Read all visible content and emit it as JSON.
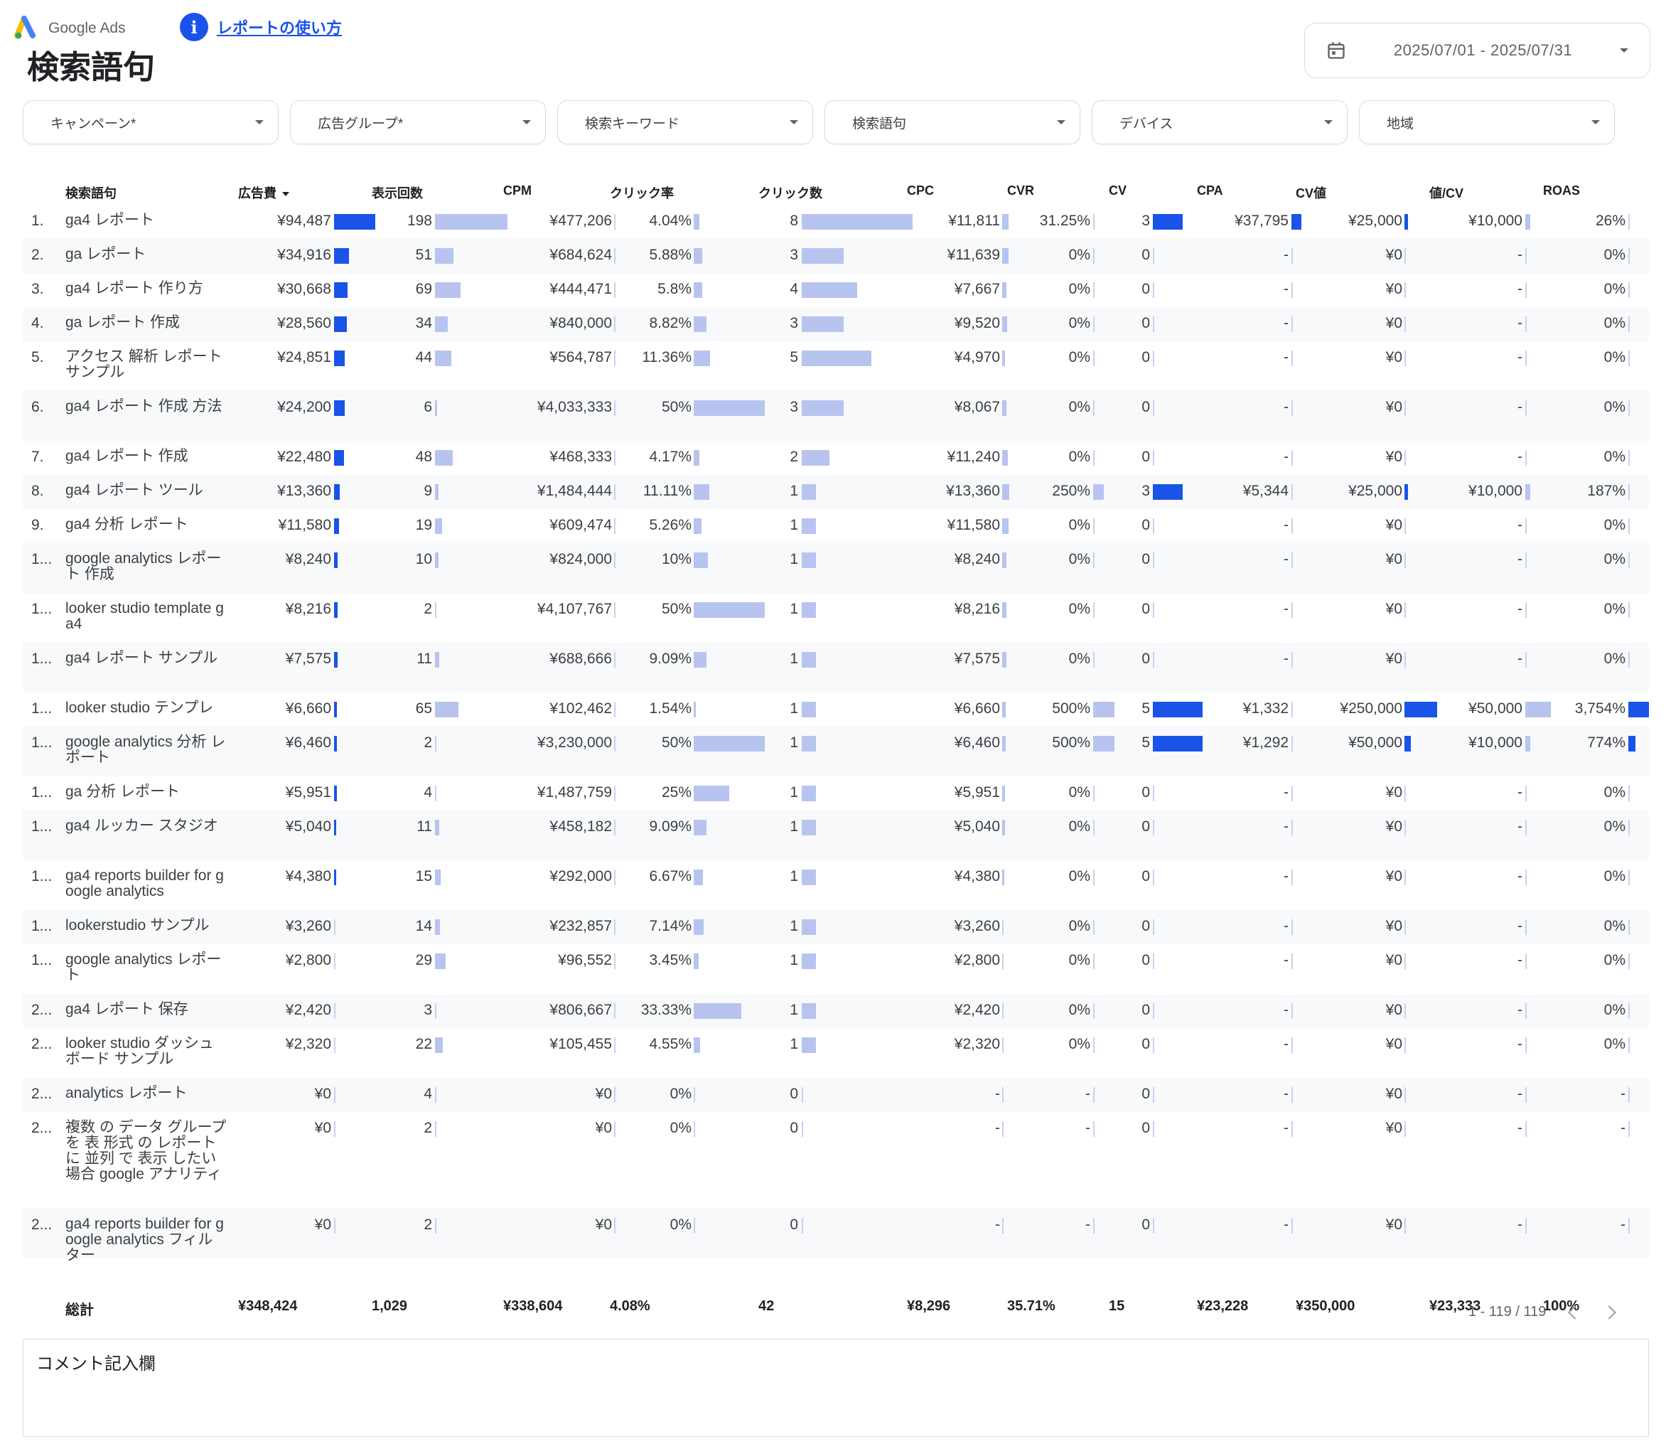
{
  "header": {
    "logo_text": "Google Ads",
    "help_label": "レポートの使い方",
    "title": "検索語句",
    "date_range": "2025/07/01 - 2025/07/31"
  },
  "filters": [
    "キャンペーン*",
    "広告グループ*",
    "検索キーワード",
    "検索語句",
    "デバイス",
    "地域"
  ],
  "columns": [
    "検索語句",
    "広告費",
    "表示回数",
    "CPM",
    "クリック率",
    "クリック数",
    "CPC",
    "CVR",
    "CV",
    "CPA",
    "CV値",
    "値/CV",
    "ROAS"
  ],
  "rows": [
    {
      "idx": "1.",
      "term": "ga4 レポート",
      "cost": "¥94,487",
      "imp": "198",
      "cpm": "¥477,206",
      "ctr": "4.04%",
      "clicks": "8",
      "cpc": "¥11,811",
      "cvr": "31.25%",
      "cv": "3",
      "cpa": "¥37,795",
      "cvv": "¥25,000",
      "vcv": "¥10,000",
      "roas": "26%"
    },
    {
      "idx": "2.",
      "term": "ga レポート",
      "cost": "¥34,916",
      "imp": "51",
      "cpm": "¥684,624",
      "ctr": "5.88%",
      "clicks": "3",
      "cpc": "¥11,639",
      "cvr": "0%",
      "cv": "0",
      "cpa": "-",
      "cvv": "¥0",
      "vcv": "-",
      "roas": "0%"
    },
    {
      "idx": "3.",
      "term": "ga4 レポート 作り方",
      "cost": "¥30,668",
      "imp": "69",
      "cpm": "¥444,471",
      "ctr": "5.8%",
      "clicks": "4",
      "cpc": "¥7,667",
      "cvr": "0%",
      "cv": "0",
      "cpa": "-",
      "cvv": "¥0",
      "vcv": "-",
      "roas": "0%"
    },
    {
      "idx": "4.",
      "term": "ga レポート 作成",
      "cost": "¥28,560",
      "imp": "34",
      "cpm": "¥840,000",
      "ctr": "8.82%",
      "clicks": "3",
      "cpc": "¥9,520",
      "cvr": "0%",
      "cv": "0",
      "cpa": "-",
      "cvv": "¥0",
      "vcv": "-",
      "roas": "0%"
    },
    {
      "idx": "5.",
      "term": "アクセス 解析 レポート サンプル",
      "cost": "¥24,851",
      "imp": "44",
      "cpm": "¥564,787",
      "ctr": "11.36%",
      "clicks": "5",
      "cpc": "¥4,970",
      "cvr": "0%",
      "cv": "0",
      "cpa": "-",
      "cvv": "¥0",
      "vcv": "-",
      "roas": "0%"
    },
    {
      "idx": "6.",
      "term": "ga4 レポート 作成 方法",
      "cost": "¥24,200",
      "imp": "6",
      "cpm": "¥4,033,333",
      "ctr": "50%",
      "clicks": "3",
      "cpc": "¥8,067",
      "cvr": "0%",
      "cv": "0",
      "cpa": "-",
      "cvv": "¥0",
      "vcv": "-",
      "roas": "0%"
    },
    {
      "idx": "7.",
      "term": "ga4 レポート 作成",
      "cost": "¥22,480",
      "imp": "48",
      "cpm": "¥468,333",
      "ctr": "4.17%",
      "clicks": "2",
      "cpc": "¥11,240",
      "cvr": "0%",
      "cv": "0",
      "cpa": "-",
      "cvv": "¥0",
      "vcv": "-",
      "roas": "0%"
    },
    {
      "idx": "8.",
      "term": "ga4 レポート ツール",
      "cost": "¥13,360",
      "imp": "9",
      "cpm": "¥1,484,444",
      "ctr": "11.11%",
      "clicks": "1",
      "cpc": "¥13,360",
      "cvr": "250%",
      "cv": "3",
      "cpa": "¥5,344",
      "cvv": "¥25,000",
      "vcv": "¥10,000",
      "roas": "187%"
    },
    {
      "idx": "9.",
      "term": "ga4 分析 レポート",
      "cost": "¥11,580",
      "imp": "19",
      "cpm": "¥609,474",
      "ctr": "5.26%",
      "clicks": "1",
      "cpc": "¥11,580",
      "cvr": "0%",
      "cv": "0",
      "cpa": "-",
      "cvv": "¥0",
      "vcv": "-",
      "roas": "0%"
    },
    {
      "idx": "1...",
      "term": "google analytics レポート 作成",
      "cost": "¥8,240",
      "imp": "10",
      "cpm": "¥824,000",
      "ctr": "10%",
      "clicks": "1",
      "cpc": "¥8,240",
      "cvr": "0%",
      "cv": "0",
      "cpa": "-",
      "cvv": "¥0",
      "vcv": "-",
      "roas": "0%"
    },
    {
      "idx": "1...",
      "term": "looker studio template ga4",
      "cost": "¥8,216",
      "imp": "2",
      "cpm": "¥4,107,767",
      "ctr": "50%",
      "clicks": "1",
      "cpc": "¥8,216",
      "cvr": "0%",
      "cv": "0",
      "cpa": "-",
      "cvv": "¥0",
      "vcv": "-",
      "roas": "0%"
    },
    {
      "idx": "1...",
      "term": "ga4 レポート サンプル",
      "cost": "¥7,575",
      "imp": "11",
      "cpm": "¥688,666",
      "ctr": "9.09%",
      "clicks": "1",
      "cpc": "¥7,575",
      "cvr": "0%",
      "cv": "0",
      "cpa": "-",
      "cvv": "¥0",
      "vcv": "-",
      "roas": "0%"
    },
    {
      "idx": "1...",
      "term": "looker studio テンプレ",
      "cost": "¥6,660",
      "imp": "65",
      "cpm": "¥102,462",
      "ctr": "1.54%",
      "clicks": "1",
      "cpc": "¥6,660",
      "cvr": "500%",
      "cv": "5",
      "cpa": "¥1,332",
      "cvv": "¥250,000",
      "vcv": "¥50,000",
      "roas": "3,754%"
    },
    {
      "idx": "1...",
      "term": "google analytics 分析 レポート",
      "cost": "¥6,460",
      "imp": "2",
      "cpm": "¥3,230,000",
      "ctr": "50%",
      "clicks": "1",
      "cpc": "¥6,460",
      "cvr": "500%",
      "cv": "5",
      "cpa": "¥1,292",
      "cvv": "¥50,000",
      "vcv": "¥10,000",
      "roas": "774%"
    },
    {
      "idx": "1...",
      "term": "ga 分析 レポート",
      "cost": "¥5,951",
      "imp": "4",
      "cpm": "¥1,487,759",
      "ctr": "25%",
      "clicks": "1",
      "cpc": "¥5,951",
      "cvr": "0%",
      "cv": "0",
      "cpa": "-",
      "cvv": "¥0",
      "vcv": "-",
      "roas": "0%"
    },
    {
      "idx": "1...",
      "term": "ga4 ルッカー スタジオ",
      "cost": "¥5,040",
      "imp": "11",
      "cpm": "¥458,182",
      "ctr": "9.09%",
      "clicks": "1",
      "cpc": "¥5,040",
      "cvr": "0%",
      "cv": "0",
      "cpa": "-",
      "cvv": "¥0",
      "vcv": "-",
      "roas": "0%"
    },
    {
      "idx": "1...",
      "term": "ga4 reports builder for google analytics",
      "cost": "¥4,380",
      "imp": "15",
      "cpm": "¥292,000",
      "ctr": "6.67%",
      "clicks": "1",
      "cpc": "¥4,380",
      "cvr": "0%",
      "cv": "0",
      "cpa": "-",
      "cvv": "¥0",
      "vcv": "-",
      "roas": "0%"
    },
    {
      "idx": "1...",
      "term": "lookerstudio サンプル",
      "cost": "¥3,260",
      "imp": "14",
      "cpm": "¥232,857",
      "ctr": "7.14%",
      "clicks": "1",
      "cpc": "¥3,260",
      "cvr": "0%",
      "cv": "0",
      "cpa": "-",
      "cvv": "¥0",
      "vcv": "-",
      "roas": "0%"
    },
    {
      "idx": "1...",
      "term": "google analytics レポート",
      "cost": "¥2,800",
      "imp": "29",
      "cpm": "¥96,552",
      "ctr": "3.45%",
      "clicks": "1",
      "cpc": "¥2,800",
      "cvr": "0%",
      "cv": "0",
      "cpa": "-",
      "cvv": "¥0",
      "vcv": "-",
      "roas": "0%"
    },
    {
      "idx": "2...",
      "term": "ga4 レポート 保存",
      "cost": "¥2,420",
      "imp": "3",
      "cpm": "¥806,667",
      "ctr": "33.33%",
      "clicks": "1",
      "cpc": "¥2,420",
      "cvr": "0%",
      "cv": "0",
      "cpa": "-",
      "cvv": "¥0",
      "vcv": "-",
      "roas": "0%"
    },
    {
      "idx": "2...",
      "term": "looker studio ダッシュボード サンプル",
      "cost": "¥2,320",
      "imp": "22",
      "cpm": "¥105,455",
      "ctr": "4.55%",
      "clicks": "1",
      "cpc": "¥2,320",
      "cvr": "0%",
      "cv": "0",
      "cpa": "-",
      "cvv": "¥0",
      "vcv": "-",
      "roas": "0%"
    },
    {
      "idx": "2...",
      "term": "analytics レポート",
      "cost": "¥0",
      "imp": "4",
      "cpm": "¥0",
      "ctr": "0%",
      "clicks": "0",
      "cpc": "-",
      "cvr": "-",
      "cv": "0",
      "cpa": "-",
      "cvv": "¥0",
      "vcv": "-",
      "roas": "-"
    },
    {
      "idx": "2...",
      "term": "複数 の データ グループ を 表 形式 の レポート に 並列 で 表示 したい 場合 google アナリティ",
      "cost": "¥0",
      "imp": "2",
      "cpm": "¥0",
      "ctr": "0%",
      "clicks": "0",
      "cpc": "-",
      "cvr": "-",
      "cv": "0",
      "cpa": "-",
      "cvv": "¥0",
      "vcv": "-",
      "roas": "-"
    },
    {
      "idx": "2...",
      "term": "ga4 reports builder for google analytics フィルター",
      "cost": "¥0",
      "imp": "2",
      "cpm": "¥0",
      "ctr": "0%",
      "clicks": "0",
      "cpc": "-",
      "cvr": "-",
      "cv": "0",
      "cpa": "-",
      "cvv": "¥0",
      "vcv": "-",
      "roas": "-"
    }
  ],
  "bar_metrics": {
    "cost": [
      94487,
      34916,
      30668,
      28560,
      24851,
      24200,
      22480,
      13360,
      11580,
      8240,
      8216,
      7575,
      6660,
      6460,
      5951,
      5040,
      4380,
      3260,
      2800,
      2420,
      2320,
      0,
      0,
      0
    ],
    "imp": [
      198,
      51,
      69,
      34,
      44,
      6,
      48,
      9,
      19,
      10,
      2,
      11,
      65,
      2,
      4,
      11,
      15,
      14,
      29,
      3,
      22,
      4,
      2,
      2
    ],
    "cpm": [
      477206,
      684624,
      444471,
      840000,
      564787,
      4033333,
      468333,
      1484444,
      609474,
      824000,
      4107767,
      688666,
      102462,
      3230000,
      1487759,
      458182,
      292000,
      232857,
      96552,
      806667,
      105455,
      0,
      0,
      0
    ],
    "ctr": [
      4.04,
      5.88,
      5.8,
      8.82,
      11.36,
      50,
      4.17,
      11.11,
      5.26,
      10,
      50,
      9.09,
      1.54,
      50,
      25,
      9.09,
      6.67,
      7.14,
      3.45,
      33.33,
      4.55,
      0,
      0,
      0
    ],
    "clicks": [
      8,
      3,
      4,
      3,
      5,
      3,
      2,
      1,
      1,
      1,
      1,
      1,
      1,
      1,
      1,
      1,
      1,
      1,
      1,
      1,
      1,
      0,
      0,
      0
    ],
    "cpc": [
      11811,
      11639,
      7667,
      9520,
      4970,
      8067,
      11240,
      13360,
      11580,
      8240,
      8216,
      7575,
      6660,
      6460,
      5951,
      5040,
      4380,
      3260,
      2800,
      2420,
      2320,
      0,
      0,
      0
    ],
    "cvr": [
      31.25,
      0,
      0,
      0,
      0,
      0,
      0,
      250,
      0,
      0,
      0,
      0,
      500,
      500,
      0,
      0,
      0,
      0,
      0,
      0,
      0,
      0,
      0,
      0
    ],
    "cv": [
      3,
      0,
      0,
      0,
      0,
      0,
      0,
      3,
      0,
      0,
      0,
      0,
      5,
      5,
      0,
      0,
      0,
      0,
      0,
      0,
      0,
      0,
      0,
      0
    ],
    "cpa": [
      37795,
      0,
      0,
      0,
      0,
      0,
      0,
      5344,
      0,
      0,
      0,
      0,
      1332,
      1292,
      0,
      0,
      0,
      0,
      0,
      0,
      0,
      0,
      0,
      0
    ],
    "cvv": [
      25000,
      0,
      0,
      0,
      0,
      0,
      0,
      25000,
      0,
      0,
      0,
      0,
      250000,
      50000,
      0,
      0,
      0,
      0,
      0,
      0,
      0,
      0,
      0,
      0
    ],
    "vcv": [
      10000,
      0,
      0,
      0,
      0,
      0,
      0,
      10000,
      0,
      0,
      0,
      0,
      50000,
      10000,
      0,
      0,
      0,
      0,
      0,
      0,
      0,
      0,
      0,
      0
    ],
    "roas": [
      26,
      0,
      0,
      0,
      0,
      0,
      0,
      187,
      0,
      0,
      0,
      0,
      3754,
      774,
      0,
      0,
      0,
      0,
      0,
      0,
      0,
      0,
      0,
      0
    ]
  },
  "totals": {
    "label": "総計",
    "cost": "¥348,424",
    "imp": "1,029",
    "cpm": "¥338,604",
    "ctr": "4.08%",
    "clicks": "42",
    "cpc": "¥8,296",
    "cvr": "35.71%",
    "cv": "15",
    "cpa": "¥23,228",
    "cvv": "¥350,000",
    "vcv": "¥23,333",
    "roas": "100%"
  },
  "pagination": "1 - 119 / 119",
  "comment_title": "コメント記入欄",
  "colors": {
    "accent": "#1a53e8",
    "bar_dark": "#1a53e8",
    "bar_light": "#b8c4f0"
  }
}
